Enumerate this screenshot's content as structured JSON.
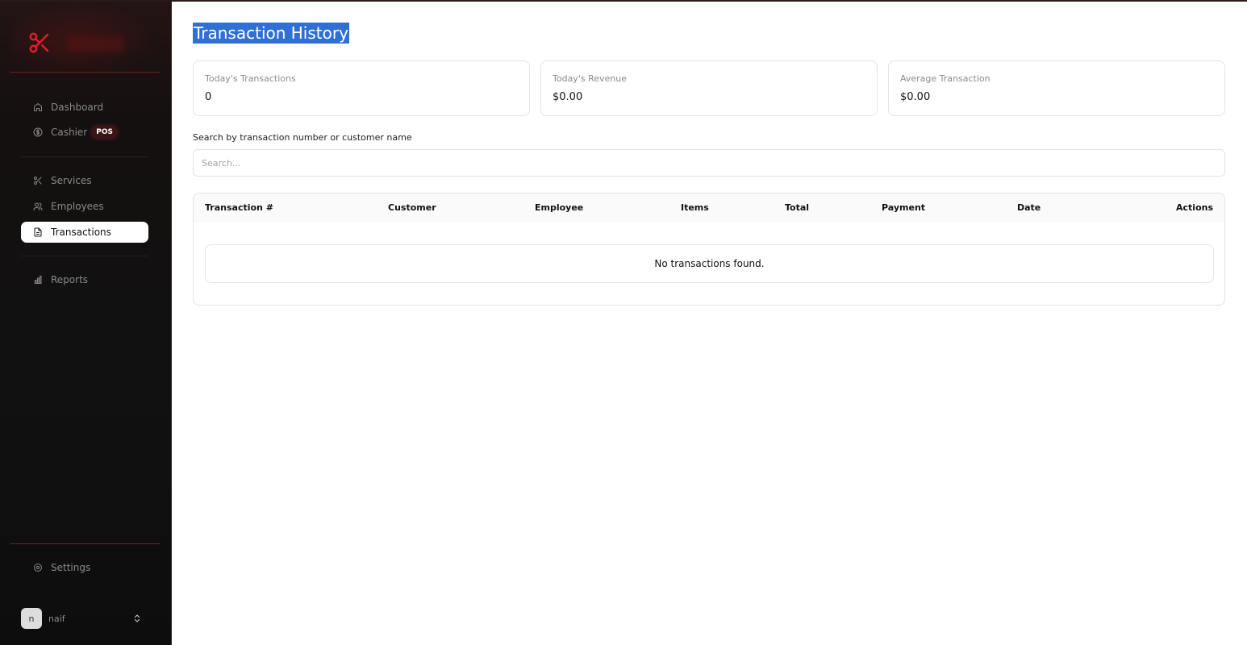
{
  "sidebar": {
    "nav_primary": [
      {
        "label": "Dashboard",
        "icon": "home-icon"
      },
      {
        "label": "Cashier",
        "icon": "dollar-icon",
        "badge": "POS"
      }
    ],
    "nav_secondary": [
      {
        "label": "Services",
        "icon": "scissors-icon"
      },
      {
        "label": "Employees",
        "icon": "users-icon"
      },
      {
        "label": "Transactions",
        "icon": "file-icon",
        "active": true
      }
    ],
    "nav_tertiary": [
      {
        "label": "Reports",
        "icon": "bar-chart-icon"
      }
    ],
    "settings_label": "Settings",
    "user": {
      "initial": "n",
      "name": "naif"
    }
  },
  "main": {
    "title": "Transaction History",
    "stats": [
      {
        "label": "Today's Transactions",
        "value": "0"
      },
      {
        "label": "Today's Revenue",
        "value": "$0.00"
      },
      {
        "label": "Average Transaction",
        "value": "$0.00"
      }
    ],
    "search": {
      "label": "Search by transaction number or customer name",
      "placeholder": "Search...",
      "value": ""
    },
    "table": {
      "columns": [
        "Transaction #",
        "Customer",
        "Employee",
        "Items",
        "Total",
        "Payment",
        "Date",
        "Actions"
      ],
      "empty_message": "No transactions found."
    }
  },
  "colors": {
    "accent_red": "#e11d2a",
    "sidebar_bg": "#111111",
    "selection_blue": "#2f6fd6"
  }
}
